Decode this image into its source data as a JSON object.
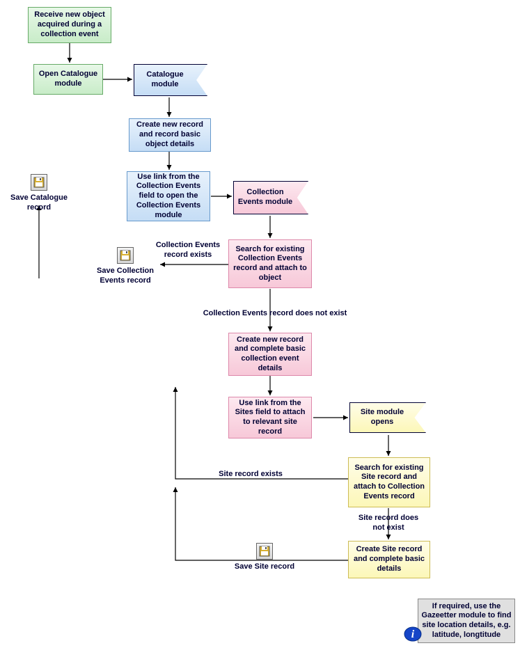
{
  "nodes": {
    "receive": "Receive new object acquired during a collection event",
    "open_catalogue": "Open Catalogue module",
    "catalogue_module": "Catalogue module",
    "create_record": "Create new record and record basic object details",
    "use_link_ce": "Use link from the Collection Events field to open the Collection Events module",
    "ce_module": "Collection Events module",
    "search_ce": "Search for existing Collection Events record and attach to object",
    "create_ce": "Create new  record and complete basic collection event details",
    "use_link_sites": "Use  link from the Sites field to attach to relevant site record",
    "site_module": "Site  module opens",
    "search_site": "Search for existing Site record and attach to Collection Events record",
    "create_site": "Create Site record and complete basic details",
    "gazetteer": "If required, use the Gazeetter module to find site location details, e.g. latitude, longtitude"
  },
  "saves": {
    "catalogue": "Save Catalogue record",
    "ce": "Save Collection Events  record",
    "site": "Save Site record"
  },
  "edges": {
    "ce_exists": "Collection Events record exists",
    "ce_not_exist": "Collection Events record does not exist",
    "site_exists": "Site record exists",
    "site_not_exist": "Site record does not exist"
  }
}
